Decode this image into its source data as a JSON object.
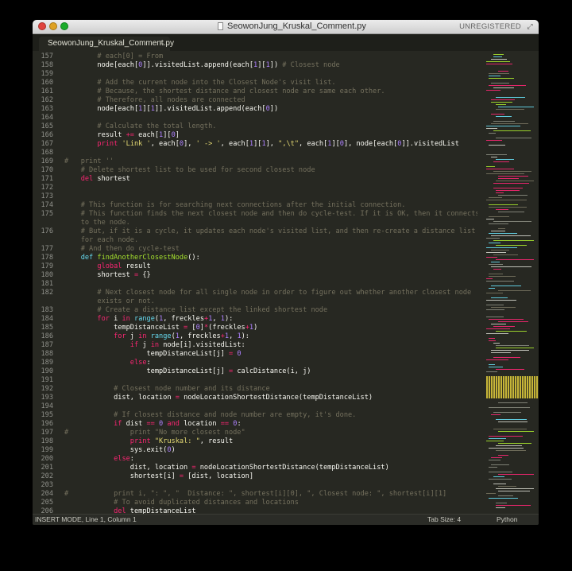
{
  "window": {
    "title": "SeowonJung_Kruskal_Comment.py",
    "license_badge": "UNREGISTERED",
    "controls": [
      "close",
      "minimize",
      "maximize"
    ],
    "icons": {
      "document": "document-icon",
      "fullscreen": "fullscreen-icon"
    }
  },
  "tabs": [
    {
      "label": "SeowonJung_Kruskal_Comment.py",
      "close_glyph": "×"
    }
  ],
  "statusbar": {
    "mode": "INSERT MODE, Line 1, Column 1",
    "tab_size": "Tab Size: 4",
    "syntax": "Python"
  },
  "theme": {
    "background": "#272822",
    "comment": "#75715e",
    "keyword": "#f92672",
    "function": "#a6e22e",
    "string": "#e6db74",
    "number": "#ae81ff",
    "builtin": "#66d9ef"
  },
  "editor": {
    "lines": [
      {
        "num": "157",
        "tokens": [
          [
            "        ",
            ""
          ],
          [
            "# each[0] = From",
            "cm"
          ]
        ]
      },
      {
        "num": "158",
        "tokens": [
          [
            "        node[each[",
            ""
          ],
          [
            "0",
            "nm"
          ],
          [
            "]].visitedList.append(each[",
            ""
          ],
          [
            "1",
            "nm"
          ],
          [
            "][",
            ""
          ],
          [
            "1",
            "nm"
          ],
          [
            "]) ",
            ""
          ],
          [
            "# Closest node",
            "cm"
          ]
        ]
      },
      {
        "num": "159",
        "tokens": []
      },
      {
        "num": "160",
        "tokens": [
          [
            "        ",
            ""
          ],
          [
            "# Add the current node into the Closest Node's visit list.",
            "cm"
          ]
        ]
      },
      {
        "num": "161",
        "tokens": [
          [
            "        ",
            ""
          ],
          [
            "# Because, the shortest distance and closest node are same each other.",
            "cm"
          ]
        ]
      },
      {
        "num": "162",
        "tokens": [
          [
            "        ",
            ""
          ],
          [
            "# Therefore, all nodes are connected",
            "cm"
          ]
        ]
      },
      {
        "num": "163",
        "tokens": [
          [
            "        node[each[",
            ""
          ],
          [
            "1",
            "nm"
          ],
          [
            "][",
            ""
          ],
          [
            "1",
            "nm"
          ],
          [
            "]].visitedList.append(each[",
            ""
          ],
          [
            "0",
            "nm"
          ],
          [
            "])",
            ""
          ]
        ]
      },
      {
        "num": "164",
        "tokens": []
      },
      {
        "num": "165",
        "tokens": [
          [
            "        ",
            ""
          ],
          [
            "# Calculate the total length.",
            "cm"
          ]
        ]
      },
      {
        "num": "166",
        "tokens": [
          [
            "        result ",
            ""
          ],
          [
            "+=",
            "kw"
          ],
          [
            " each[",
            ""
          ],
          [
            "1",
            "nm"
          ],
          [
            "][",
            ""
          ],
          [
            "0",
            "nm"
          ],
          [
            "]",
            ""
          ]
        ]
      },
      {
        "num": "167",
        "tokens": [
          [
            "        ",
            ""
          ],
          [
            "print",
            "kw"
          ],
          [
            " ",
            ""
          ],
          [
            "'Link '",
            "st"
          ],
          [
            ", each[",
            ""
          ],
          [
            "0",
            "nm"
          ],
          [
            "], ",
            ""
          ],
          [
            "' -> '",
            "st"
          ],
          [
            ", each[",
            ""
          ],
          [
            "1",
            "nm"
          ],
          [
            "][",
            ""
          ],
          [
            "1",
            "nm"
          ],
          [
            "], ",
            ""
          ],
          [
            "\",\\t\"",
            "st"
          ],
          [
            ", each[",
            ""
          ],
          [
            "1",
            "nm"
          ],
          [
            "][",
            ""
          ],
          [
            "0",
            "nm"
          ],
          [
            "], node[each[",
            ""
          ],
          [
            "0",
            "nm"
          ],
          [
            "]].visitedList",
            ""
          ]
        ]
      },
      {
        "num": "168",
        "tokens": []
      },
      {
        "num": "169",
        "tokens": [
          [
            "#   print ''",
            "cm"
          ]
        ]
      },
      {
        "num": "170",
        "tokens": [
          [
            "    ",
            ""
          ],
          [
            "# Delete shortest list to be used for second closest node",
            "cm"
          ]
        ]
      },
      {
        "num": "171",
        "tokens": [
          [
            "    ",
            ""
          ],
          [
            "del",
            "kw"
          ],
          [
            " shortest",
            ""
          ]
        ]
      },
      {
        "num": "172",
        "tokens": []
      },
      {
        "num": "173",
        "tokens": []
      },
      {
        "num": "174",
        "tokens": [
          [
            "    ",
            ""
          ],
          [
            "# This function is for searching next connections after the initial connection.",
            "cm"
          ]
        ]
      },
      {
        "num": "175",
        "tokens": [
          [
            "    ",
            ""
          ],
          [
            "# This function finds the next closest node and then do cycle-test. If it is OK, then it connects",
            "cm"
          ]
        ]
      },
      {
        "num": "",
        "tokens": [
          [
            "    ",
            ""
          ],
          [
            "to the node.",
            "cm"
          ]
        ]
      },
      {
        "num": "176",
        "tokens": [
          [
            "    ",
            ""
          ],
          [
            "# But, if it is a cycle, it updates each node's visited list, and then re-create a distance list",
            "cm"
          ]
        ]
      },
      {
        "num": "",
        "tokens": [
          [
            "    ",
            ""
          ],
          [
            "for each node.",
            "cm"
          ]
        ]
      },
      {
        "num": "177",
        "tokens": [
          [
            "    ",
            ""
          ],
          [
            "# And then do cycle-test",
            "cm"
          ]
        ]
      },
      {
        "num": "178",
        "tokens": [
          [
            "    ",
            ""
          ],
          [
            "def",
            "sp"
          ],
          [
            " ",
            ""
          ],
          [
            "findAnotherClosestNode",
            "fn"
          ],
          [
            "():",
            ""
          ]
        ]
      },
      {
        "num": "179",
        "tokens": [
          [
            "        ",
            ""
          ],
          [
            "global",
            "kw"
          ],
          [
            " result",
            ""
          ]
        ]
      },
      {
        "num": "180",
        "tokens": [
          [
            "        shortest ",
            ""
          ],
          [
            "=",
            "kw"
          ],
          [
            " {}",
            ""
          ]
        ]
      },
      {
        "num": "181",
        "tokens": []
      },
      {
        "num": "182",
        "tokens": [
          [
            "        ",
            ""
          ],
          [
            "# Next closest node for all single node in order to figure out whether another closest node",
            "cm"
          ]
        ]
      },
      {
        "num": "",
        "tokens": [
          [
            "        ",
            ""
          ],
          [
            "exists or not.",
            "cm"
          ]
        ]
      },
      {
        "num": "183",
        "tokens": [
          [
            "        ",
            ""
          ],
          [
            "# Create a distance list except the linked shortest node",
            "cm"
          ]
        ]
      },
      {
        "num": "184",
        "tokens": [
          [
            "        ",
            ""
          ],
          [
            "for",
            "kw"
          ],
          [
            " i ",
            ""
          ],
          [
            "in",
            "kw"
          ],
          [
            " ",
            ""
          ],
          [
            "range",
            "sp"
          ],
          [
            "(",
            ""
          ],
          [
            "1",
            "nm"
          ],
          [
            ", freckles",
            ""
          ],
          [
            "+",
            "kw"
          ],
          [
            "1",
            "nm"
          ],
          [
            ", ",
            ""
          ],
          [
            "1",
            "nm"
          ],
          [
            "):",
            ""
          ]
        ]
      },
      {
        "num": "185",
        "tokens": [
          [
            "            tempDistanceList ",
            ""
          ],
          [
            "=",
            "kw"
          ],
          [
            " [",
            ""
          ],
          [
            "0",
            "nm"
          ],
          [
            "]",
            ""
          ],
          [
            "*",
            "kw"
          ],
          [
            "(freckles",
            ""
          ],
          [
            "+",
            "kw"
          ],
          [
            "1",
            "nm"
          ],
          [
            ")",
            ""
          ]
        ]
      },
      {
        "num": "186",
        "tokens": [
          [
            "            ",
            ""
          ],
          [
            "for",
            "kw"
          ],
          [
            " j ",
            ""
          ],
          [
            "in",
            "kw"
          ],
          [
            " ",
            ""
          ],
          [
            "range",
            "sp"
          ],
          [
            "(",
            ""
          ],
          [
            "1",
            "nm"
          ],
          [
            ", freckles",
            ""
          ],
          [
            "+",
            "kw"
          ],
          [
            "1",
            "nm"
          ],
          [
            ", ",
            ""
          ],
          [
            "1",
            "nm"
          ],
          [
            "):",
            ""
          ]
        ]
      },
      {
        "num": "187",
        "tokens": [
          [
            "                ",
            ""
          ],
          [
            "if",
            "kw"
          ],
          [
            " j ",
            ""
          ],
          [
            "in",
            "kw"
          ],
          [
            " node[i].visitedList:",
            ""
          ]
        ]
      },
      {
        "num": "188",
        "tokens": [
          [
            "                    tempDistanceList[j] ",
            ""
          ],
          [
            "=",
            "kw"
          ],
          [
            " ",
            ""
          ],
          [
            "0",
            "nm"
          ]
        ]
      },
      {
        "num": "189",
        "tokens": [
          [
            "                ",
            ""
          ],
          [
            "else",
            "kw"
          ],
          [
            ":",
            ""
          ]
        ]
      },
      {
        "num": "190",
        "tokens": [
          [
            "                    tempDistanceList[j] ",
            ""
          ],
          [
            "=",
            "kw"
          ],
          [
            " calcDistance(i, j)",
            ""
          ]
        ]
      },
      {
        "num": "191",
        "tokens": []
      },
      {
        "num": "192",
        "tokens": [
          [
            "            ",
            ""
          ],
          [
            "# Closest node number and its distance",
            "cm"
          ]
        ]
      },
      {
        "num": "193",
        "tokens": [
          [
            "            dist, location ",
            ""
          ],
          [
            "=",
            "kw"
          ],
          [
            " nodeLocationShortestDistance(tempDistanceList)",
            ""
          ]
        ]
      },
      {
        "num": "194",
        "tokens": []
      },
      {
        "num": "195",
        "tokens": [
          [
            "            ",
            ""
          ],
          [
            "# If closest distance and node number are empty, it's done.",
            "cm"
          ]
        ]
      },
      {
        "num": "196",
        "tokens": [
          [
            "            ",
            ""
          ],
          [
            "if",
            "kw"
          ],
          [
            " dist ",
            ""
          ],
          [
            "==",
            "kw"
          ],
          [
            " ",
            ""
          ],
          [
            "0",
            "nm"
          ],
          [
            " ",
            ""
          ],
          [
            "and",
            "kw"
          ],
          [
            " location ",
            ""
          ],
          [
            "==",
            "kw"
          ],
          [
            " ",
            ""
          ],
          [
            "0",
            "nm"
          ],
          [
            ":",
            ""
          ]
        ]
      },
      {
        "num": "197",
        "tokens": [
          [
            "#               print \"No more closest node\"",
            "cm"
          ]
        ]
      },
      {
        "num": "198",
        "tokens": [
          [
            "                ",
            ""
          ],
          [
            "print",
            "kw"
          ],
          [
            " ",
            ""
          ],
          [
            "\"Kruskal: \"",
            "st"
          ],
          [
            ", result",
            ""
          ]
        ]
      },
      {
        "num": "199",
        "tokens": [
          [
            "                sys.exit(",
            ""
          ],
          [
            "0",
            "nm"
          ],
          [
            ")",
            ""
          ]
        ]
      },
      {
        "num": "200",
        "tokens": [
          [
            "            ",
            ""
          ],
          [
            "else",
            "kw"
          ],
          [
            ":",
            ""
          ]
        ]
      },
      {
        "num": "201",
        "tokens": [
          [
            "                dist, location ",
            ""
          ],
          [
            "=",
            "kw"
          ],
          [
            " nodeLocationShortestDistance(tempDistanceList)",
            ""
          ]
        ]
      },
      {
        "num": "202",
        "tokens": [
          [
            "                shortest[i] ",
            ""
          ],
          [
            "=",
            "kw"
          ],
          [
            " [dist, location]",
            ""
          ]
        ]
      },
      {
        "num": "203",
        "tokens": []
      },
      {
        "num": "204",
        "tokens": [
          [
            "#           print i, \": \", \"  Distance: \", shortest[i][0], \", Closest node: \", shortest[i][1]",
            "cm"
          ]
        ]
      },
      {
        "num": "205",
        "tokens": [
          [
            "            ",
            ""
          ],
          [
            "# To avoid duplicated distances and locations",
            "cm"
          ]
        ]
      },
      {
        "num": "206",
        "tokens": [
          [
            "            ",
            ""
          ],
          [
            "del",
            "kw"
          ],
          [
            " tempDistanceList",
            ""
          ]
        ]
      }
    ]
  }
}
